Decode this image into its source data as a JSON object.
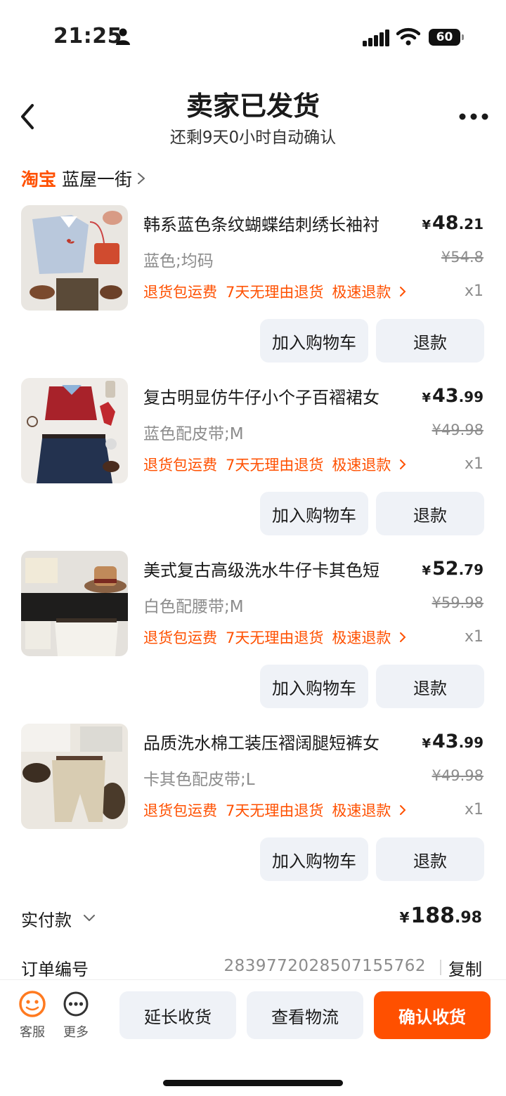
{
  "status_bar": {
    "time": "21:25",
    "battery": "60"
  },
  "header": {
    "title": "卖家已发货",
    "subtitle": "还剩9天0小时自动确认"
  },
  "shop": {
    "logo": "淘宝",
    "name": "蓝屋一街"
  },
  "items": [
    {
      "title": "韩系蓝色条纹蝴蝶结刺绣长袖衬",
      "price_symbol": "¥",
      "price_int": "48",
      "price_dec": ".21",
      "variant": "蓝色;均码",
      "original_price": "¥54.8",
      "services": [
        "退货包运费",
        "7天无理由退货",
        "极速退款"
      ],
      "qty": "x1",
      "cart_label": "加入购物车",
      "refund_label": "退款"
    },
    {
      "title": "复古明显仿牛仔小个子百褶裙女",
      "price_symbol": "¥",
      "price_int": "43",
      "price_dec": ".99",
      "variant": "蓝色配皮带;M",
      "original_price": "¥49.98",
      "services": [
        "退货包运费",
        "7天无理由退货",
        "极速退款"
      ],
      "qty": "x1",
      "cart_label": "加入购物车",
      "refund_label": "退款"
    },
    {
      "title": "美式复古高级洗水牛仔卡其色短",
      "price_symbol": "¥",
      "price_int": "52",
      "price_dec": ".79",
      "variant": "白色配腰带;M",
      "original_price": "¥59.98",
      "services": [
        "退货包运费",
        "7天无理由退货",
        "极速退款"
      ],
      "qty": "x1",
      "cart_label": "加入购物车",
      "refund_label": "退款"
    },
    {
      "title": "品质洗水棉工装压褶阔腿短裤女",
      "price_symbol": "¥",
      "price_int": "43",
      "price_dec": ".99",
      "variant": "卡其色配皮带;L",
      "original_price": "¥49.98",
      "services": [
        "退货包运费",
        "7天无理由退货",
        "极速退款"
      ],
      "qty": "x1",
      "cart_label": "加入购物车",
      "refund_label": "退款"
    }
  ],
  "payment": {
    "label": "实付款",
    "symbol": "¥",
    "int": "188",
    "dec": ".98"
  },
  "order": {
    "label": "订单编号",
    "number": "2839772028507155762",
    "copy_label": "复制"
  },
  "bottom_bar": {
    "service_label": "客服",
    "more_label": "更多",
    "extend_label": "延长收货",
    "logistics_label": "查看物流",
    "confirm_label": "确认收货"
  },
  "colors": {
    "accent": "#ff5000",
    "button_bg": "#eff2f7",
    "muted_text": "#8c8c8c"
  }
}
